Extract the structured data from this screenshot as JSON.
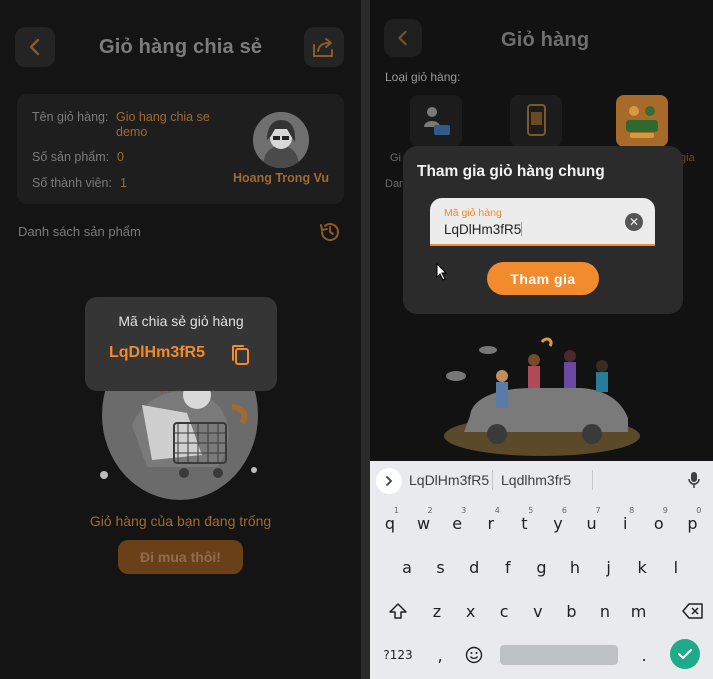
{
  "left_screen": {
    "title": "Giỏ hàng chia sẻ",
    "info": {
      "name_label": "Tên giỏ hàng:",
      "name_value_line1": "Gio hang chia se",
      "name_value_line2": "demo",
      "products_label": "Số sản phẩm:",
      "products_value": "0",
      "members_label": "Số thành viên:",
      "members_value": "1",
      "owner_name": "Hoang Trong Vu"
    },
    "product_list_label": "Danh sách sản phẩm",
    "share_popup": {
      "title": "Mã chia sẻ giỏ hàng",
      "code": "LqDlHm3fR5"
    },
    "empty_message": "Giỏ hàng của bạn đang trống",
    "shop_button": "Đi mua thôi!"
  },
  "right_screen": {
    "title": "Giỏ hàng",
    "type_label": "Loại giỏ hàng:",
    "fragments": {
      "left_under_tile": "Gi",
      "right_under_tile": "gia",
      "left_under_dialog": "Dan"
    },
    "dialog": {
      "title": "Tham gia giỏ hàng chung",
      "field_label": "Mã giỏ hàng",
      "field_value": "LqDlHm3fR5",
      "join_button": "Tham gia"
    },
    "keyboard": {
      "suggestions": [
        "LqDlHm3fR5",
        "Lqdlhm3fr5"
      ],
      "row1": [
        "q",
        "w",
        "e",
        "r",
        "t",
        "y",
        "u",
        "i",
        "o",
        "p"
      ],
      "row1_hints": [
        "1",
        "2",
        "3",
        "4",
        "5",
        "6",
        "7",
        "8",
        "9",
        "0"
      ],
      "row2": [
        "a",
        "s",
        "d",
        "f",
        "g",
        "h",
        "j",
        "k",
        "l"
      ],
      "row3": [
        "z",
        "x",
        "c",
        "v",
        "b",
        "n",
        "m"
      ],
      "symbols_key": "?123",
      "comma_key": ",",
      "period_key": "."
    }
  },
  "colors": {
    "accent": "#f28a2e",
    "background": "#141414",
    "dim_accent": "#a06a30"
  }
}
